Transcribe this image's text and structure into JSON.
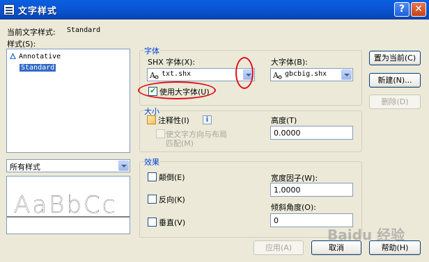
{
  "window": {
    "title": "文字样式",
    "help_glyph": "?",
    "close_glyph": "✕"
  },
  "current_style": {
    "label": "当前文字样式:",
    "value": "Standard"
  },
  "styles": {
    "label": "样式(S):",
    "items": [
      {
        "label": "Annotative",
        "selected": false,
        "icon": "annotative-icon"
      },
      {
        "label": "Standard",
        "selected": true
      }
    ]
  },
  "filter": {
    "value": "所有样式"
  },
  "preview": {
    "text": "AaBbCc"
  },
  "font": {
    "group_title": "字体",
    "shx_label": "SHX 字体(X):",
    "shx_value": "txt.shx",
    "big_label": "大字体(B):",
    "big_value": "gbcbig.shx",
    "use_big_font_label": "使用大字体(U)",
    "use_big_font_checked": true
  },
  "size": {
    "group_title": "大小",
    "annotative_label": "注释性(I)",
    "info_glyph": "i",
    "match_orientation_line1": "使文字方向与布局",
    "match_orientation_line2": "匹配(M)",
    "height_label": "高度(T)",
    "height_value": "0.0000"
  },
  "effects": {
    "group_title": "效果",
    "upside_down_label": "颠倒(E)",
    "backwards_label": "反向(K)",
    "vertical_label": "垂直(V)",
    "width_factor_label": "宽度因子(W):",
    "width_factor_value": "1.0000",
    "oblique_label": "倾斜角度(O):",
    "oblique_value": "0"
  },
  "buttons": {
    "set_current": "置为当前(C)",
    "new": "新建(N)...",
    "delete": "删除(D)",
    "apply": "应用(A)",
    "cancel": "取消",
    "help": "帮助(H)"
  },
  "watermark": "Baidu 经验",
  "colors": {
    "title_bar": "#0a57d6",
    "group_title": "#0046d5",
    "selection": "#316ac5",
    "annotation_circle": "#e0101a"
  }
}
